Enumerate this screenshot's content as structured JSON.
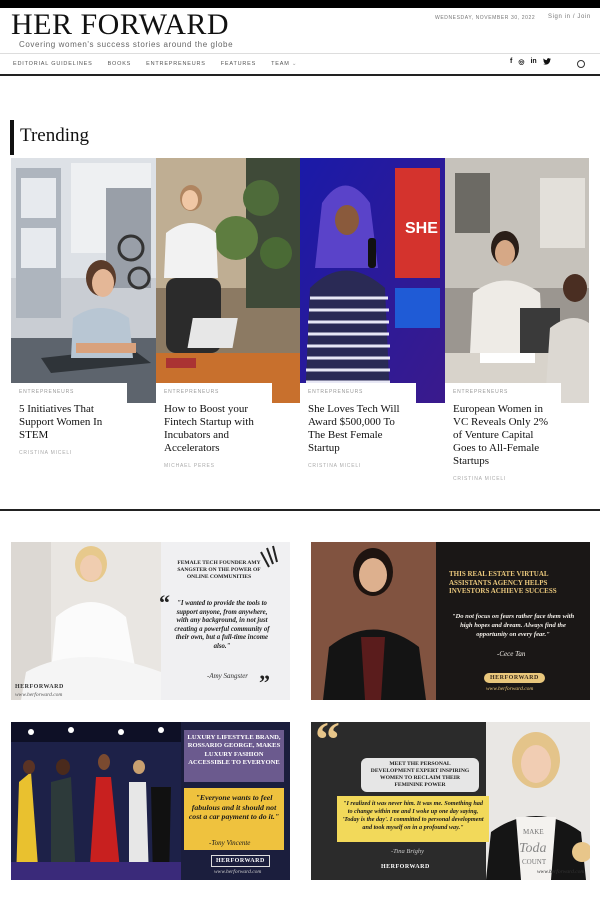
{
  "header": {
    "logo": "HER FORWARD",
    "tagline": "Covering women's success stories around the globe",
    "date": "WEDNESDAY, NOVEMBER 30, 2022",
    "signin": "Sign in / Join"
  },
  "nav": {
    "items": [
      "Editorial Guidelines",
      "Books",
      "Entrepreneurs",
      "Features",
      "Team"
    ],
    "team_chevron": "⌄",
    "social": [
      "f",
      "◎",
      "in",
      "🐦"
    ]
  },
  "trending": {
    "title": "Trending",
    "cards": [
      {
        "category": "ENTREPRENEURS",
        "title": "5 Initiatives That Support Women In STEM",
        "author": "CRISTINA MICELI"
      },
      {
        "category": "ENTREPRENEURS",
        "title": "How to Boost your Fintech Startup with Incubators and Accelerators",
        "author": "MICHAEL PERES"
      },
      {
        "category": "ENTREPRENEURS",
        "title": "She Loves Tech Will Award $500,000 To The Best Female Startup",
        "author": "CRISTINA MICELI"
      },
      {
        "category": "ENTREPRENEURS",
        "title": "European Women in VC Reveals Only 2% of Venture Capital Goes to All-Female Startups",
        "author": "CRISTINA MICELI"
      }
    ]
  },
  "promos": [
    {
      "headline": "FEMALE TECH FOUNDER AMY SANGSTER ON THE POWER OF ONLINE COMMUNITIES",
      "quote": "\"I wanted to provide the tools to support anyone, from anywhere, with any background, in not just creating a powerful community of their own, but a full-time income also.\"",
      "signature": "-Amy Sangster",
      "brand": "HERFORWARD",
      "url": "www.herforward.com"
    },
    {
      "headline": "THIS REAL ESTATE VIRTUAL ASSISTANTS AGENCY HELPS INVESTORS ACHIEVE SUCCESS",
      "quote": "\"Do not focus on fears rather face them with high hopes and dream. Always find the opportunity on every fear.\"",
      "signature": "-Cece Tan",
      "brand": "HERFORWARD",
      "url": "www.herforward.com"
    },
    {
      "headline": "LUXURY LIFESTYLE BRAND, ROSSARIO GEORGE, MAKES LUXURY FASHION ACCESSIBLE TO EVERYONE",
      "quote": "\"Everyone wants to feel fabulous and it should not cost a car payment to do it.\"",
      "signature": "-Tony Vincente",
      "brand": "HERFORWARD",
      "url": "www.herforward.com"
    },
    {
      "headline": "MEET THE PERSONAL DEVELOPMENT EXPERT INSPIRING WOMEN TO RECLAIM THEIR FEMININE POWER",
      "quote": "\"I realized it was never him. It was me. Something had to change within me and I woke up one day saying, 'Today is the day'. I committed to personal development and took myself on in a profound way.\"",
      "signature": "-Tina Brighy",
      "brand": "HERFORWARD",
      "url": "www.herforward.com"
    }
  ],
  "colors": {
    "accent_black": "#111111",
    "promo2_bg": "#1a1716",
    "promo2_gold": "#e9c77c",
    "promo3_yellow": "#efc23e",
    "promo4_bg": "#2b2b2b",
    "promo4_yellow": "#f2d95a"
  }
}
